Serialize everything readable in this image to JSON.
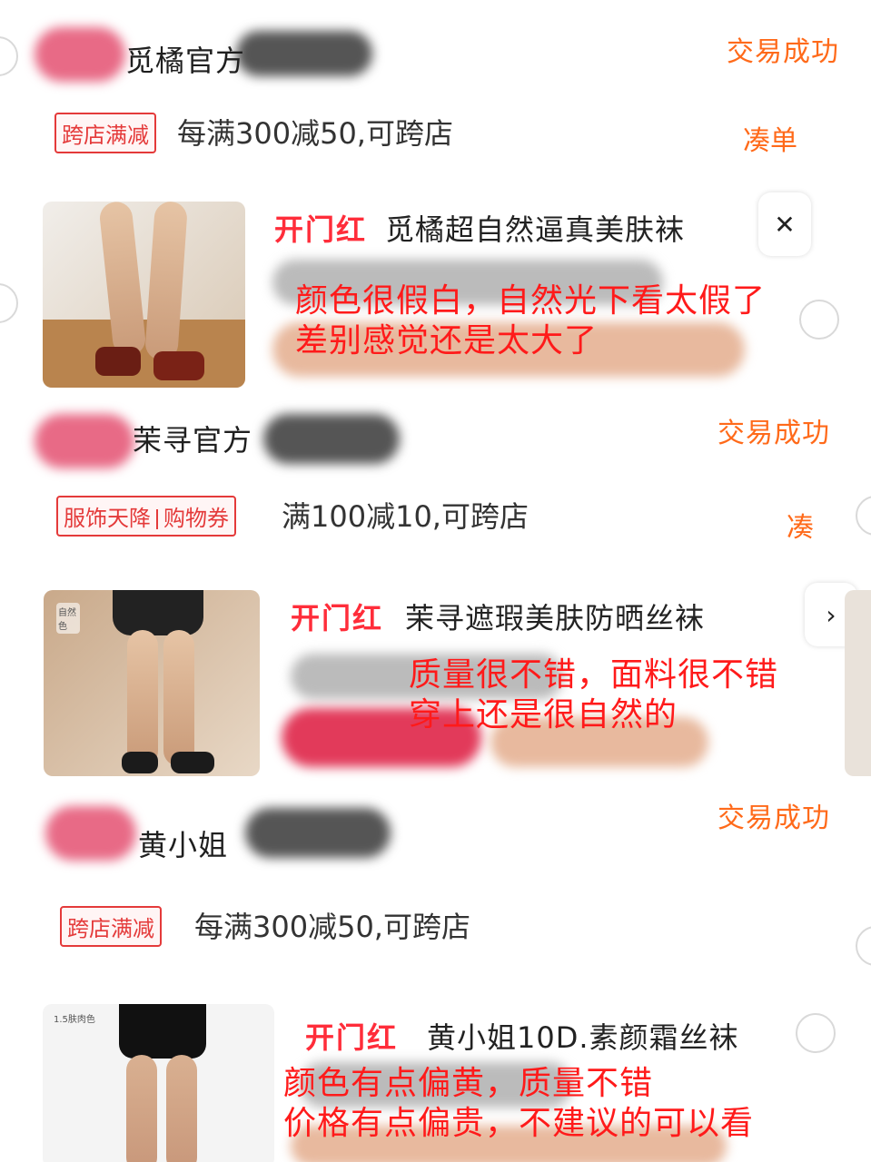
{
  "orders": [
    {
      "shop_name": "觅橘官方",
      "status": "交易成功",
      "promo_tags": [
        "跨店满减"
      ],
      "promo_text": "每满300减50,可跨店",
      "action": "凑单",
      "badge": "开门红",
      "product_title": "觅橘超自然逼真美肤袜",
      "review_lines": [
        "颜色很假白，自然光下看太假了",
        "差别感觉还是太大了"
      ]
    },
    {
      "shop_name": "茉寻官方",
      "status": "交易成功",
      "promo_tags": [
        "服饰天降",
        "购物券"
      ],
      "promo_text": "满100减10,可跨店",
      "action": "凑",
      "badge": "开门红",
      "product_title": "茉寻遮瑕美肤防晒丝袜",
      "thumb_label": "自然色",
      "review_lines": [
        "质量很不错，面料很不错",
        "穿上还是很自然的"
      ]
    },
    {
      "shop_name": "黄小姐",
      "status": "交易成功",
      "promo_tags": [
        "跨店满减"
      ],
      "promo_text": "每满300减50,可跨店",
      "badge": "开门红",
      "product_title": "黄小姐10D.素颜霜丝袜",
      "thumb_label": "1.5肤肉色",
      "review_lines": [
        "颜色有点偏黄，质量不错",
        "价格有点偏贵，不建议的可以看"
      ]
    }
  ],
  "colors": {
    "accent_orange": "#ff6a1a",
    "badge_red": "#ff2d3a",
    "review_red": "#ff1a1a"
  }
}
